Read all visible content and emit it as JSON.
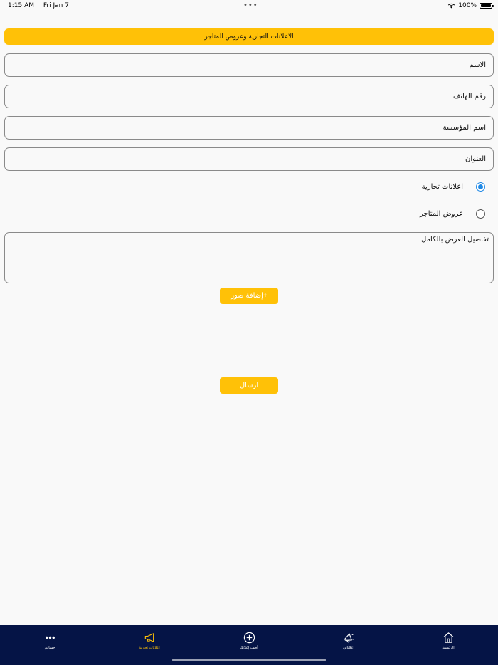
{
  "status": {
    "time": "1:15 AM",
    "date": "Fri Jan 7",
    "dots": "•••",
    "battery": "100%"
  },
  "header": {
    "title": "الاعلانات التجارية وعروض المتاجر"
  },
  "form": {
    "name_placeholder": "الاسم",
    "phone_placeholder": "رقم الهاتف",
    "org_placeholder": "اسم المؤسسة",
    "address_placeholder": "العنوان",
    "radio_ads_label": "اعلانات تجارية",
    "radio_stores_label": "عروض المتاجر",
    "details_placeholder": "تفاصيل العرض بالكامل",
    "add_images_label": "+إضافة صور",
    "submit_label": "ارسال"
  },
  "tabbar": {
    "items": [
      {
        "label": "الرئيسية",
        "icon": "home-icon"
      },
      {
        "label": "اعلاناتي",
        "icon": "megaphone-icon"
      },
      {
        "label": "أضف إعلانك",
        "icon": "plus-circle-icon"
      },
      {
        "label": "اعلانات تجارية",
        "icon": "bullhorn-icon"
      },
      {
        "label": "حسابي",
        "icon": "more-icon"
      }
    ]
  },
  "colors": {
    "accent": "#ffc107",
    "tabbar_bg": "#051446",
    "radio_active": "#1e88e5"
  }
}
